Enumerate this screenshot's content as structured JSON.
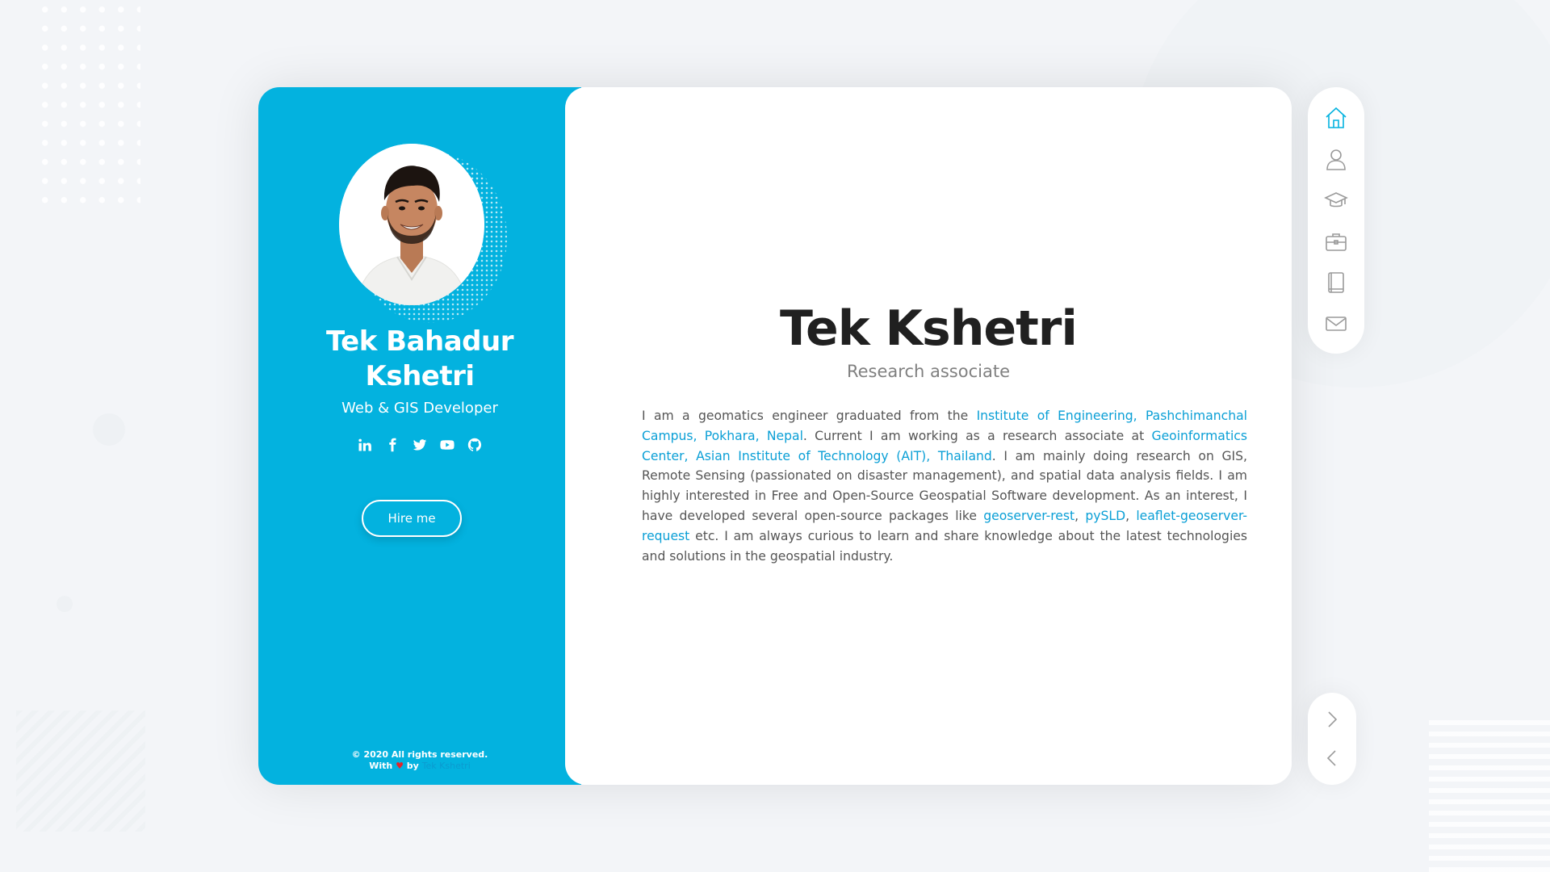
{
  "colors": {
    "accent": "#03b2df",
    "link": "#0a9fd6",
    "heart": "#e3242b"
  },
  "sidebar": {
    "name_line1": "Tek Bahadur",
    "name_line2": "Kshetri",
    "role": "Web & GIS Developer",
    "socials": [
      {
        "icon": "linkedin-icon"
      },
      {
        "icon": "facebook-icon"
      },
      {
        "icon": "twitter-icon"
      },
      {
        "icon": "youtube-icon"
      },
      {
        "icon": "github-icon"
      }
    ],
    "hire_label": "Hire me",
    "footer_line1": "© 2020 All rights reserved.",
    "footer_with": "With",
    "footer_heart": "♥",
    "footer_by": "by",
    "footer_author": "Tek Kshetri"
  },
  "main": {
    "title": "Tek Kshetri",
    "subtitle": "Research associate",
    "bio": {
      "t1": "I am a geomatics engineer graduated from the ",
      "l1": "Institute of Engineering, Pashchimanchal Campus, Pokhara, Nepal",
      "t2": ". Current I am working as a research associate at ",
      "l2": "Geoinformatics Center, Asian Institute of Technology (AIT), Thailand",
      "t3": ". I am mainly doing research on GIS, Remote Sensing (passionated on disaster management), and spatial data analysis fields. I am highly interested in Free and Open-Source Geospatial Software development. As an interest, I have developed several open-source packages like ",
      "l3": "geoserver-rest",
      "t4": ", ",
      "l4": "pySLD",
      "t5": ", ",
      "l5": "leaflet-geoserver-request",
      "t6": " etc. I am always curious to learn and share knowledge about the latest technologies and solutions in the geospatial industry."
    }
  },
  "nav": {
    "items": [
      {
        "icon": "home-icon",
        "active": true
      },
      {
        "icon": "user-icon",
        "active": false
      },
      {
        "icon": "graduation-cap-icon",
        "active": false
      },
      {
        "icon": "briefcase-icon",
        "active": false
      },
      {
        "icon": "book-icon",
        "active": false
      },
      {
        "icon": "mail-icon",
        "active": false
      }
    ],
    "arrows": [
      {
        "icon": "chevron-right-icon"
      },
      {
        "icon": "chevron-left-icon"
      }
    ]
  }
}
